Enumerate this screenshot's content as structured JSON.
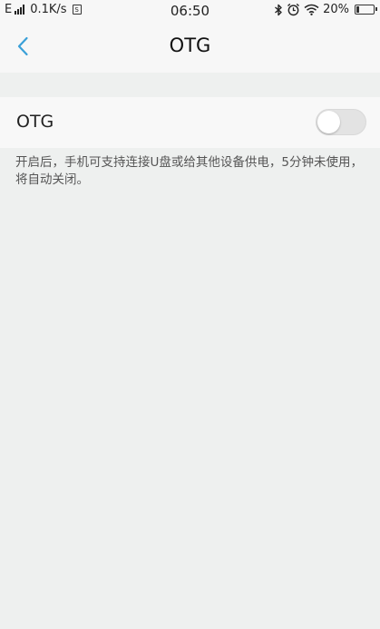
{
  "status_bar": {
    "carrier": "E",
    "net_speed": "0.1K/s",
    "sim_label": "S",
    "time": "06:50",
    "battery": "20%",
    "battery_level": 0.2,
    "icons": [
      "bluetooth-icon",
      "alarm-icon",
      "wifi-icon",
      "battery-icon"
    ]
  },
  "header": {
    "title": "OTG",
    "back_icon": "chevron-left-icon",
    "accent_color": "#3aa0d8"
  },
  "setting": {
    "label": "OTG",
    "enabled": false,
    "description": "开启后，手机可支持连接U盘或给其他设备供电，5分钟未使用，将自动关闭。"
  }
}
